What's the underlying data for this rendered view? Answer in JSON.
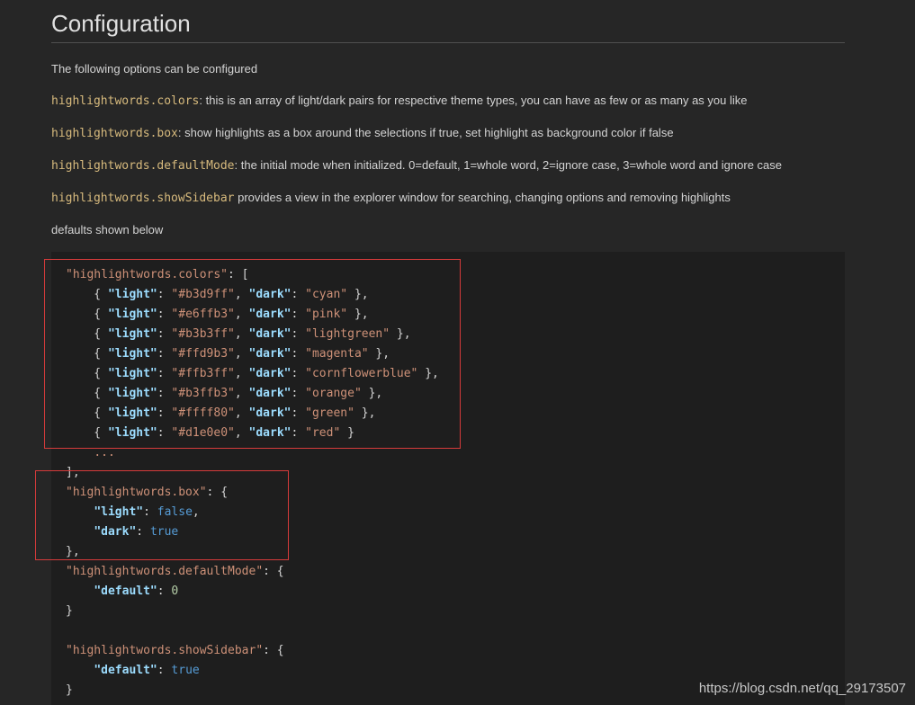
{
  "heading": "Configuration",
  "intro": "The following options can be configured",
  "options": [
    {
      "name": "highlightwords.colors",
      "desc": ": this is an array of light/dark pairs for respective theme types, you can have as few or as many as you like"
    },
    {
      "name": "highlightwords.box",
      "desc": ": show highlights as a box around the selections if true, set highlight as background color if false"
    },
    {
      "name": "highlightwords.defaultMode",
      "desc": ": the initial mode when initialized. 0=default, 1=whole word, 2=ignore case, 3=whole word and ignore case"
    },
    {
      "name": "highlightwords.showSidebar",
      "desc": " provides a view in the explorer window for searching, changing options and removing highlights"
    }
  ],
  "defaults_text": "defaults shown below",
  "code": {
    "colors_key": "\"highlightwords.colors\"",
    "light_key": "\"light\"",
    "dark_key": "\"dark\"",
    "default_key": "\"default\"",
    "color_pairs": [
      {
        "light": "\"#b3d9ff\"",
        "dark": "\"cyan\"",
        "end": " },"
      },
      {
        "light": "\"#e6ffb3\"",
        "dark": "\"pink\"",
        "end": " },"
      },
      {
        "light": "\"#b3b3ff\"",
        "dark": "\"lightgreen\"",
        "end": " },"
      },
      {
        "light": "\"#ffd9b3\"",
        "dark": "\"magenta\"",
        "end": " },"
      },
      {
        "light": "\"#ffb3ff\"",
        "dark": "\"cornflowerblue\"",
        "end": " },"
      },
      {
        "light": "\"#b3ffb3\"",
        "dark": "\"orange\"",
        "end": " },"
      },
      {
        "light": "\"#ffff80\"",
        "dark": "\"green\"",
        "end": " },"
      },
      {
        "light": "\"#d1e0e0\"",
        "dark": "\"red\"",
        "end": " }"
      }
    ],
    "ellipsis": "...",
    "box_key": "\"highlightwords.box\"",
    "box_light": "false",
    "box_dark": "true",
    "default_mode_key": "\"highlightwords.defaultMode\"",
    "default_mode_value": "0",
    "show_sidebar_key": "\"highlightwords.showSidebar\"",
    "show_sidebar_value": "true"
  },
  "watermark": "https://blog.csdn.net/qq_29173507",
  "colors": {
    "background": "#262626",
    "code_background": "#1e1e1e",
    "option_name": "#d7ba7d",
    "string": "#ce9178",
    "property": "#9cdcfe",
    "keyword": "#569cd6",
    "number": "#b5cea8",
    "annotation_box": "#d63b3b"
  }
}
